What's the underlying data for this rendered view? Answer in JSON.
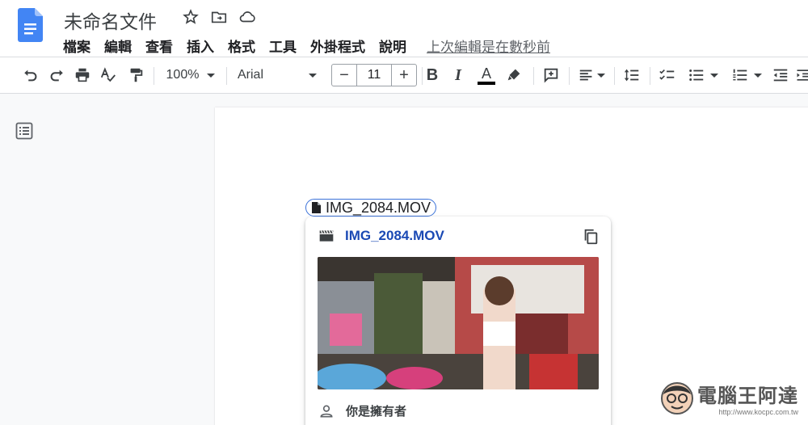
{
  "doc": {
    "title": "未命名文件",
    "menu": [
      "檔案",
      "編輯",
      "查看",
      "插入",
      "格式",
      "工具",
      "外掛程式",
      "說明"
    ],
    "last_edit": "上次編輯是在數秒前"
  },
  "toolbar": {
    "zoom": "100%",
    "font": "Arial",
    "font_size": "11",
    "minus": "−",
    "plus": "+",
    "bold": "B",
    "italic": "I",
    "text_color_letter": "A"
  },
  "chip": {
    "label": "IMG_2084.MOV"
  },
  "card": {
    "title": "IMG_2084.MOV",
    "owner": "你是擁有者"
  },
  "watermark": {
    "name": "電腦王阿達",
    "url": "http://www.kocpc.com.tw"
  },
  "colors": {
    "accent": "#1a49b4",
    "chip_border": "#3b72d9",
    "docs_blue": "#4285f4"
  }
}
